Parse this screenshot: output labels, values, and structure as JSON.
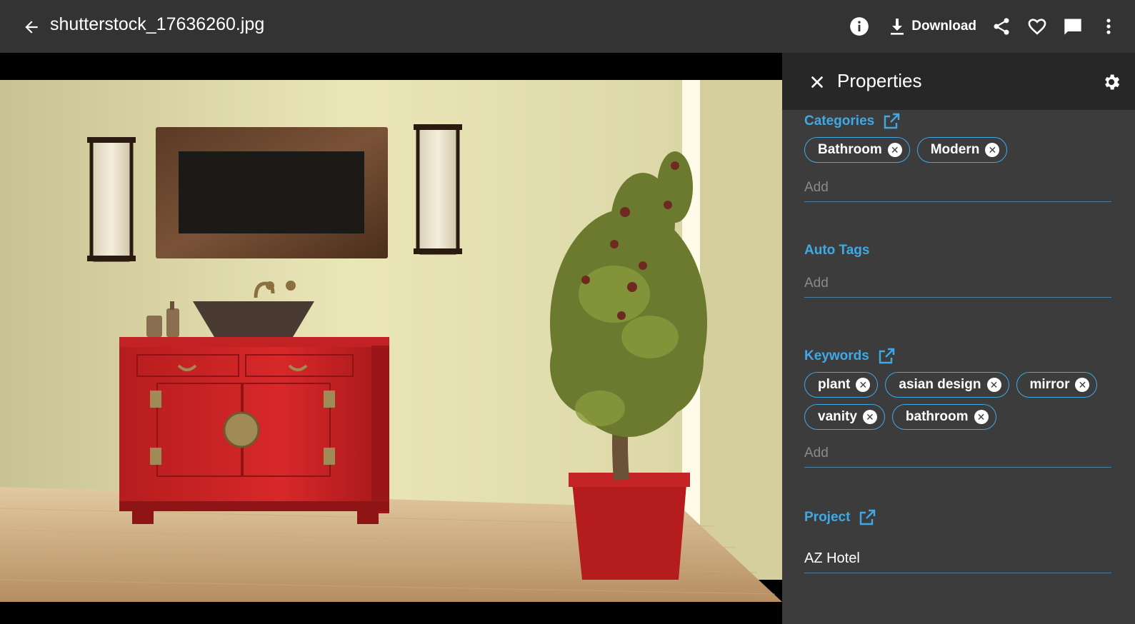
{
  "header": {
    "filename": "shutterstock_17636260.jpg",
    "download_label": "Download"
  },
  "icons": {
    "back": "arrow-left-icon",
    "info": "info-icon",
    "download": "download-icon",
    "share": "share-icon",
    "favorite": "heart-icon",
    "comment": "comment-icon",
    "more": "more-vertical-icon",
    "close": "close-icon",
    "settings": "gear-icon",
    "external": "external-link-icon"
  },
  "panel": {
    "title": "Properties",
    "categories": {
      "label": "Categories",
      "chips": [
        "Bathroom",
        "Modern"
      ],
      "add_placeholder": "Add"
    },
    "auto_tags": {
      "label": "Auto Tags",
      "add_placeholder": "Add"
    },
    "keywords": {
      "label": "Keywords",
      "chips": [
        "plant",
        "asian design",
        "mirror",
        "vanity",
        "bathroom"
      ],
      "add_placeholder": "Add"
    },
    "project": {
      "label": "Project",
      "value": "AZ Hotel"
    }
  },
  "colors": {
    "topbar": "#333333",
    "panel": "#3c3c3c",
    "panel_header": "#272727",
    "accent": "#3fa9e6"
  }
}
